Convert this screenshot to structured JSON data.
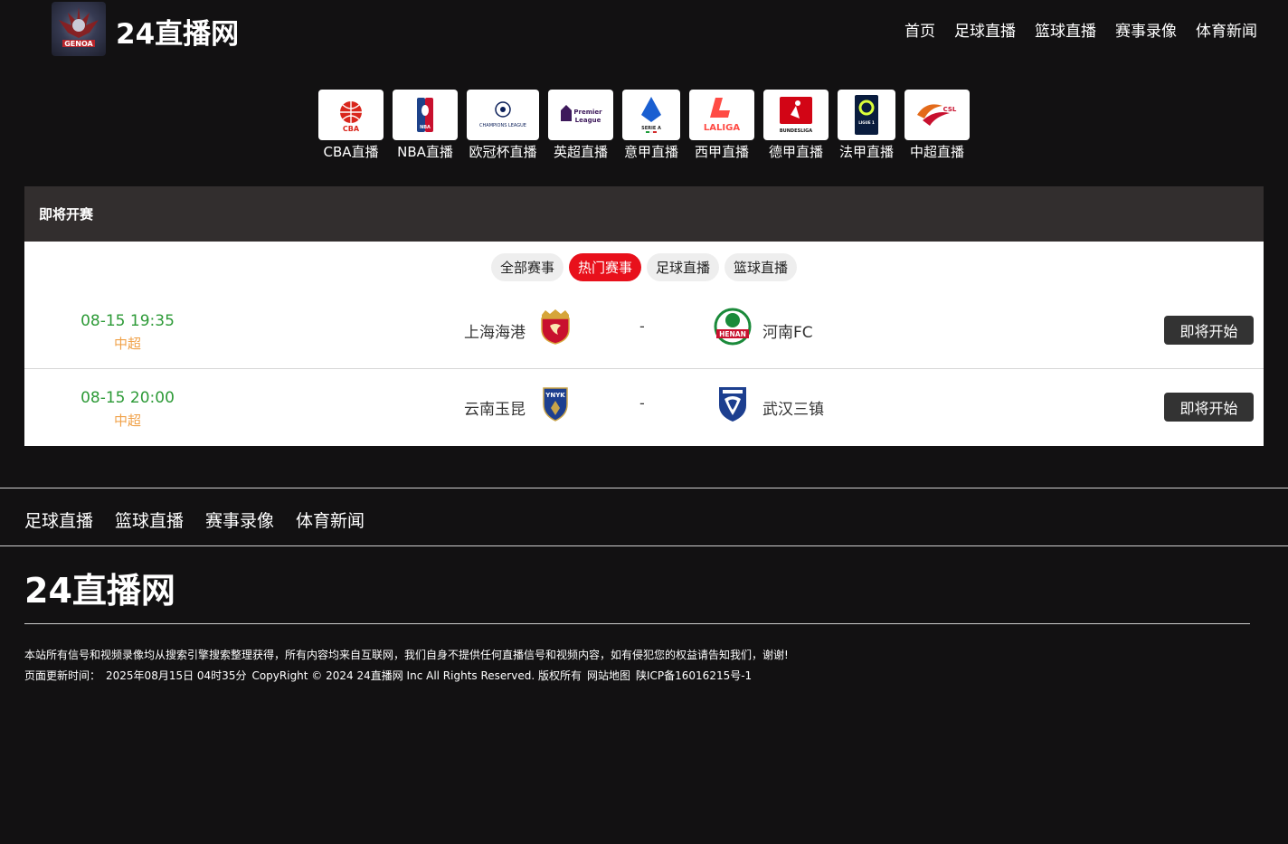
{
  "site": {
    "name": "24直播网"
  },
  "nav": {
    "items": [
      "首页",
      "足球直播",
      "篮球直播",
      "赛事录像",
      "体育新闻"
    ]
  },
  "leagues": [
    {
      "label": "CBA直播",
      "icon": "cba-logo-icon",
      "logo_text": "CBA",
      "color": "#d9261c"
    },
    {
      "label": "NBA直播",
      "icon": "nba-logo-icon",
      "logo_text": "NBA",
      "color": "#1d428a"
    },
    {
      "label": "欧冠杯直播",
      "icon": "champions-league-logo-icon",
      "logo_text": "CHAMPIONS LEAGUE",
      "color": "#0b1f59"
    },
    {
      "label": "英超直播",
      "icon": "premier-league-logo-icon",
      "logo_text": "Premier League",
      "color": "#3d195b"
    },
    {
      "label": "意甲直播",
      "icon": "serie-a-logo-icon",
      "logo_text": "SERIE A",
      "color": "#1a5fd1"
    },
    {
      "label": "西甲直播",
      "icon": "laliga-logo-icon",
      "logo_text": "LALIGA",
      "color": "#ff4b44"
    },
    {
      "label": "德甲直播",
      "icon": "bundesliga-logo-icon",
      "logo_text": "BUNDESLIGA",
      "color": "#d20515"
    },
    {
      "label": "法甲直播",
      "icon": "ligue1-logo-icon",
      "logo_text": "LIGUE 1",
      "color": "#091c3e"
    },
    {
      "label": "中超直播",
      "icon": "csl-logo-icon",
      "logo_text": "CSL",
      "color": "#e36a1a"
    }
  ],
  "panel": {
    "title": "即将开赛",
    "filters": [
      {
        "label": "全部赛事",
        "active": false
      },
      {
        "label": "热门赛事",
        "active": true
      },
      {
        "label": "足球直播",
        "active": false
      },
      {
        "label": "篮球直播",
        "active": false
      }
    ],
    "matches": [
      {
        "time": "08-15 19:35",
        "league": "中超",
        "home": "上海海港",
        "home_icon": "shanghai-port-logo-icon",
        "separator": "-",
        "away": "河南FC",
        "away_icon": "henan-fc-logo-icon",
        "status": "即将开始"
      },
      {
        "time": "08-15 20:00",
        "league": "中超",
        "home": "云南玉昆",
        "home_icon": "yunnan-yukun-logo-icon",
        "separator": "-",
        "away": "武汉三镇",
        "away_icon": "wuhan-three-towns-logo-icon",
        "status": "即将开始"
      }
    ]
  },
  "footer": {
    "nav": [
      "足球直播",
      "篮球直播",
      "赛事录像",
      "体育新闻"
    ],
    "brand": "24直播网",
    "disclaimer": "本站所有信号和视频录像均从搜索引擎搜索整理获得，所有内容均来自互联网，我们自身不提供任何直播信号和视频内容，如有侵犯您的权益请告知我们，谢谢!",
    "updated_label": "页面更新时间：",
    "updated_time": "2025年08月15日 04时35分",
    "copyright": "CopyRight © 2024 24直播网 Inc All Rights Reserved. 版权所有",
    "sitemap": "网站地图",
    "icp": "陕ICP备16016215号-1"
  },
  "colors": {
    "accent": "#e8101b",
    "time_green": "#2d9a37",
    "league_orange": "#f0a24a",
    "panel_header": "#322e2e",
    "background": "#121112"
  }
}
